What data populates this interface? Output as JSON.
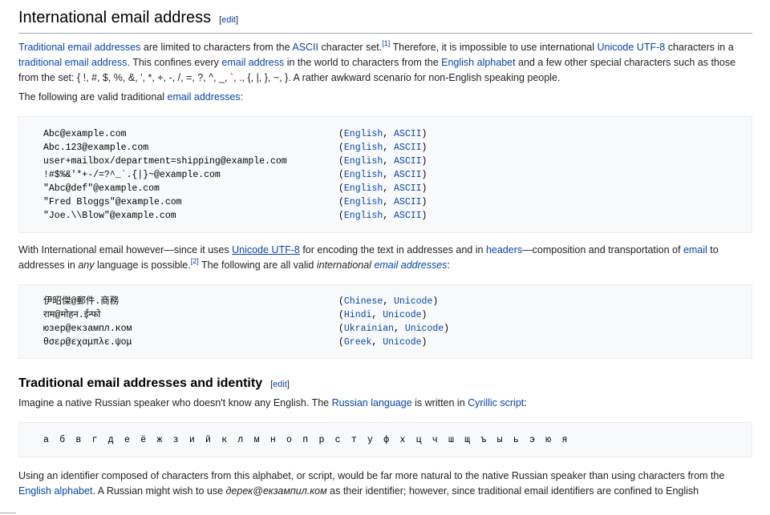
{
  "section1": {
    "heading": "International email address",
    "edit": "edit",
    "para1": {
      "a1": "Traditional email addresses",
      "t1": " are limited to characters from the ",
      "a2": "ASCII",
      "t2": " character set.",
      "ref1": "[1]",
      "t3": " Therefore, it is impossible to use international ",
      "a3": "Unicode UTF-8",
      "t4": " characters in a ",
      "a4": "traditional email address",
      "t5": ". This confines every ",
      "a5": "email address",
      "t6": " in the world to characters from the ",
      "a6": "English alphabet",
      "t7": " and a few other special characters such as those from the set: { !, #, $, %, &, ', *, +, -, /, =, ?, ^, _, `, ., {, |, }, ~, }. A rather awkward scenario for non-English speaking people."
    },
    "para2": {
      "t1": "The following are valid traditional ",
      "a1": "email addresses",
      "t2": ":"
    },
    "traditional_examples": [
      {
        "address": "Abc@example.com",
        "lang": "English",
        "charset": "ASCII"
      },
      {
        "address": "Abc.123@example.com",
        "lang": "English",
        "charset": "ASCII"
      },
      {
        "address": "user+mailbox/department=shipping@example.com",
        "lang": "English",
        "charset": "ASCII"
      },
      {
        "address": "!#$%&'*+-/=?^_`.{|}~@example.com",
        "lang": "English",
        "charset": "ASCII"
      },
      {
        "address": "\"Abc@def\"@example.com",
        "lang": "English",
        "charset": "ASCII"
      },
      {
        "address": "\"Fred Bloggs\"@example.com",
        "lang": "English",
        "charset": "ASCII"
      },
      {
        "address": "\"Joe.\\\\Blow\"@example.com",
        "lang": "English",
        "charset": "ASCII"
      }
    ],
    "para3": {
      "t1": "With International email however—since it uses ",
      "a1": "Unicode UTF-8",
      "t2": " for encoding the text in addresses and in ",
      "a2": "headers",
      "t3": "—composition and transportation of ",
      "a3": "email",
      "t4": " to addresses in ",
      "em1": "any",
      "t5": " language is possible.",
      "ref2": "[2]",
      "t6": " The following are all valid ",
      "em2": "international",
      "t7": " ",
      "a4": "email addresses",
      "t8": ":"
    },
    "international_examples": [
      {
        "address": "伊昭傑@郵件.商務",
        "lang": "Chinese",
        "charset": "Unicode"
      },
      {
        "address": "राम@मोहन.ईन्फो",
        "lang": "Hindi",
        "charset": "Unicode"
      },
      {
        "address": "юзер@екзампл.ком",
        "lang": "Ukrainian",
        "charset": "Unicode"
      },
      {
        "address": "θσερ@εχαμπλε.ψομ",
        "lang": "Greek",
        "charset": "Unicode"
      }
    ]
  },
  "section2": {
    "heading": "Traditional email addresses and identity",
    "edit": "edit",
    "para1": {
      "t1": "Imagine a native Russian speaker who doesn't know any English. The ",
      "a1": "Russian language",
      "t2": " is written in ",
      "a2": "Cyrillic script",
      "t3": ":"
    },
    "alphabet": "а б в г д е ё ж з и й к л м н о п р с т у ф х ц ч ш щ ъ ы ь э ю я",
    "para2": {
      "t1": "Using an identifier composed of characters from this alphabet, or script, would be far more natural to the native Russian speaker than using characters from the ",
      "a1": "English alphabet",
      "t2": ". A Russian might wish to use ",
      "em1": "дерек@екзампил.ком",
      "t3": " as their identifier; however, since traditional email identifiers are confined to English"
    }
  }
}
